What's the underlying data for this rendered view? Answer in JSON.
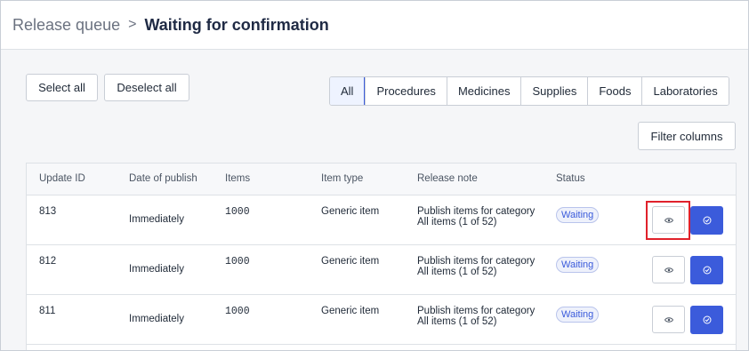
{
  "breadcrumb": {
    "root": "Release queue",
    "separator": ">",
    "current": "Waiting for confirmation"
  },
  "actions": {
    "select_all": "Select all",
    "deselect_all": "Deselect all",
    "filter_columns": "Filter columns"
  },
  "filters": [
    {
      "label": "All",
      "active": true
    },
    {
      "label": "Procedures",
      "active": false
    },
    {
      "label": "Medicines",
      "active": false
    },
    {
      "label": "Supplies",
      "active": false
    },
    {
      "label": "Foods",
      "active": false
    },
    {
      "label": "Laboratories",
      "active": false
    }
  ],
  "table": {
    "columns": [
      "Update ID",
      "Date of publish",
      "Items",
      "Item type",
      "Release note",
      "Status"
    ],
    "rows": [
      {
        "id": "813",
        "date": "Immediately",
        "items": "1000",
        "type": "Generic item",
        "note_line1": "Publish items for category",
        "note_line2": "All items (1 of 52)",
        "status": "Waiting",
        "highlighted": true
      },
      {
        "id": "812",
        "date": "Immediately",
        "items": "1000",
        "type": "Generic item",
        "note_line1": "Publish items for category",
        "note_line2": "All items (1 of 52)",
        "status": "Waiting",
        "highlighted": false
      },
      {
        "id": "811",
        "date": "Immediately",
        "items": "1000",
        "type": "Generic item",
        "note_line1": "Publish items for category",
        "note_line2": "All items (1 of 52)",
        "status": "Waiting",
        "highlighted": false
      }
    ]
  },
  "icons": {
    "view": "eye-icon",
    "confirm": "check-circle-icon"
  },
  "colors": {
    "accent": "#3b5bdb",
    "highlight": "#e0212b"
  }
}
